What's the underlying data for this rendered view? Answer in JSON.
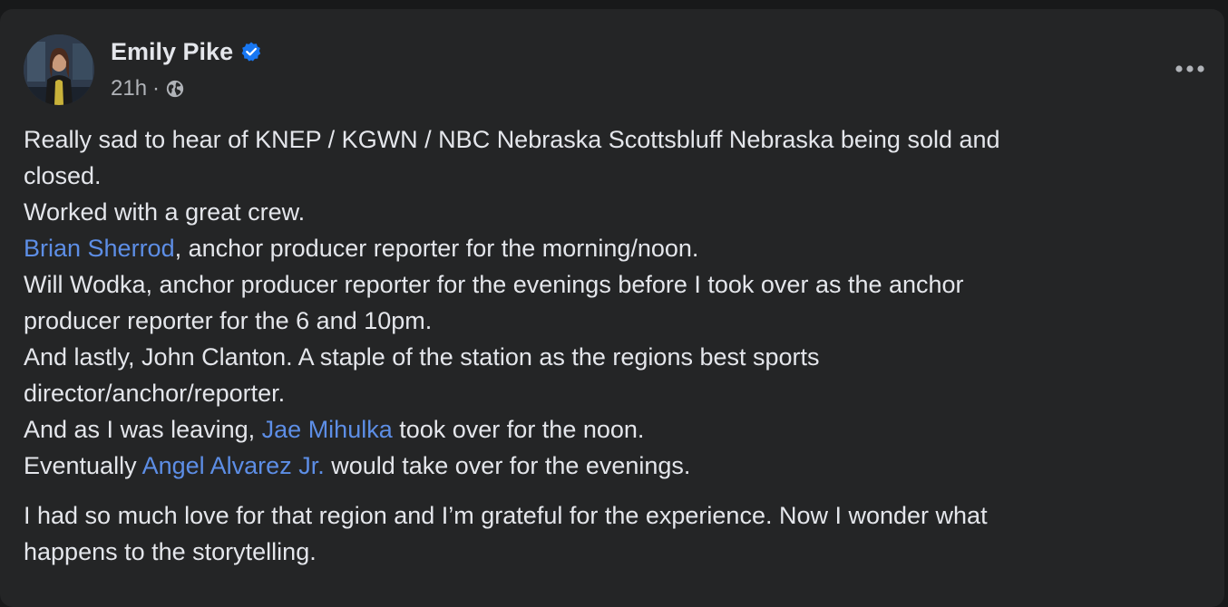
{
  "post": {
    "author": "Emily Pike",
    "time": "21h",
    "separator": "·",
    "privacy_icon": "globe-icon",
    "verified_icon": "verified-badge-icon",
    "more_icon": "more-options-icon",
    "paragraph1": {
      "line1": "Really sad to hear of KNEP / KGWN / NBC Nebraska Scottsbluff Nebraska being sold and",
      "line2": "closed.",
      "line3": "Worked with a great crew.",
      "mention_brian": "Brian Sherrod",
      "line4_rest": ", anchor producer reporter for the morning/noon.",
      "line5": "Will Wodka, anchor producer reporter for the evenings before I took over as the anchor",
      "line6": "producer reporter for the 6 and 10pm.",
      "line7": "And lastly, John Clanton. A staple of the station as the regions best sports",
      "line8": "director/anchor/reporter.",
      "line9_pre": "And as I was leaving, ",
      "mention_jae": "Jae Mihulka",
      "line9_post": " took over for the noon.",
      "line10_pre": "Eventually ",
      "mention_angel": "Angel Alvarez Jr.",
      "line10_post": " would take over for the evenings."
    },
    "paragraph2": {
      "line1": "I had so much love for that region and I’m grateful for the experience. Now I wonder what",
      "line2": "happens to the storytelling."
    }
  },
  "colors": {
    "background": "#242526",
    "text": "#e4e6eb",
    "secondary_text": "#b0b3b8",
    "mention": "#5d8ee6",
    "verified": "#1877f2"
  }
}
